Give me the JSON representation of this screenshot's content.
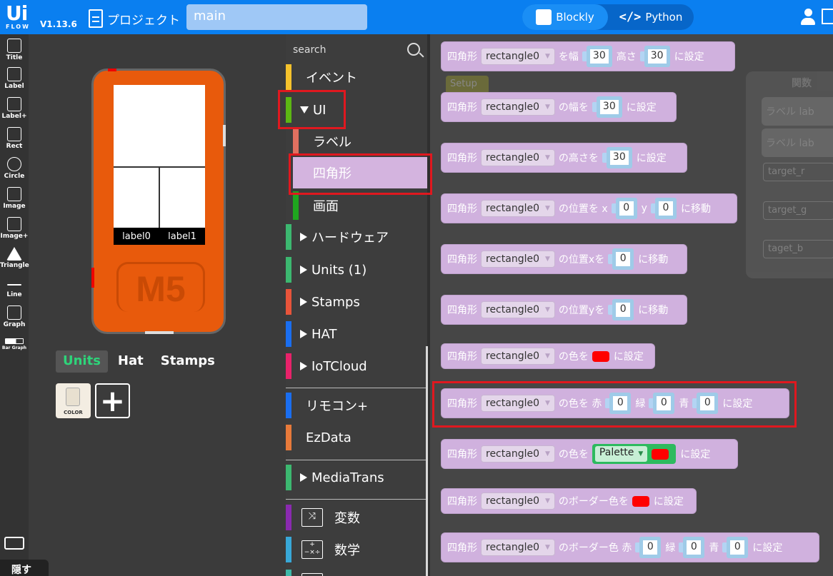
{
  "topbar": {
    "logo_top": "Ui",
    "logo_bottom": "FLOW",
    "version": "V1.13.6",
    "project_label": "プロジェクト",
    "file_name": "main",
    "mode_blockly": "Blockly",
    "mode_python": "Python",
    "mode_python_glyph": "</>"
  },
  "toolstrip": {
    "items": [
      "Title",
      "Label",
      "Label+",
      "Rect",
      "Circle",
      "Image",
      "Image+",
      "Triangle",
      "Line",
      "Graph",
      "Bar Graph"
    ],
    "hide_label": "隠す"
  },
  "device": {
    "label0": "label0",
    "label1": "label1",
    "brand": "M5"
  },
  "bottom_tabs": {
    "units": "Units",
    "hat": "Hat",
    "stamps": "Stamps",
    "unit_card_label": "COLOR",
    "add_symbol": "+"
  },
  "categories": {
    "search_placeholder": "search",
    "event": "イベント",
    "ui": "UI",
    "label": "ラベル",
    "rect": "四角形",
    "screen": "画面",
    "hardware": "ハードウェア",
    "units": "Units (1)",
    "stamps": "Stamps",
    "hat": "HAT",
    "iotcloud": "IoTCloud",
    "remocon": "リモコン+",
    "ezdata": "EzData",
    "mediatrans": "MediaTrans",
    "variables": "変数",
    "math": "数学",
    "var_icon": "⤨",
    "math_icon": "+−×÷"
  },
  "ghost": {
    "title": "関数",
    "setup": "Setup",
    "row1": "ラベル lab",
    "row2": "ラベル lab",
    "f1": "target_r",
    "f2": "target_g",
    "f3": "taget_b"
  },
  "blocks": {
    "rect": "四角形",
    "target": "rectangle0",
    "b1": {
      "t1": "を幅",
      "v1": "30",
      "t2": "高さ",
      "v2": "30",
      "t3": "に設定"
    },
    "b2": {
      "t1": "の幅を",
      "v1": "30",
      "t2": "に設定"
    },
    "b3": {
      "t1": "の高さを",
      "v1": "30",
      "t2": "に設定"
    },
    "b4": {
      "t1": "の位置を x",
      "v1": "0",
      "t2": "y",
      "v2": "0",
      "t3": "に移動"
    },
    "b5": {
      "t1": "の位置xを",
      "v1": "0",
      "t2": "に移動"
    },
    "b6": {
      "t1": "の位置yを",
      "v1": "0",
      "t2": "に移動"
    },
    "b7": {
      "t1": "の色を",
      "t2": "に設定"
    },
    "b8": {
      "t1": "の色を 赤",
      "v1": "0",
      "t2": "緑",
      "v2": "0",
      "t3": "青",
      "v3": "0",
      "t4": "に設定"
    },
    "b9": {
      "t1": "の色を",
      "palette": "Palette",
      "t2": "に設定"
    },
    "b10": {
      "t1": "のボーダー色を",
      "t2": "に設定"
    },
    "b11": {
      "t1": "のボーダー色 赤",
      "v1": "0",
      "t2": "緑",
      "v2": "0",
      "t3": "青",
      "v3": "0",
      "t4": "に設定"
    }
  },
  "colors": {
    "topbar": "#0a7ff0",
    "block": "#d0b1de",
    "highlight": "#e0181f",
    "swatch_red": "#ff0000",
    "device_orange": "#e85a0c"
  }
}
